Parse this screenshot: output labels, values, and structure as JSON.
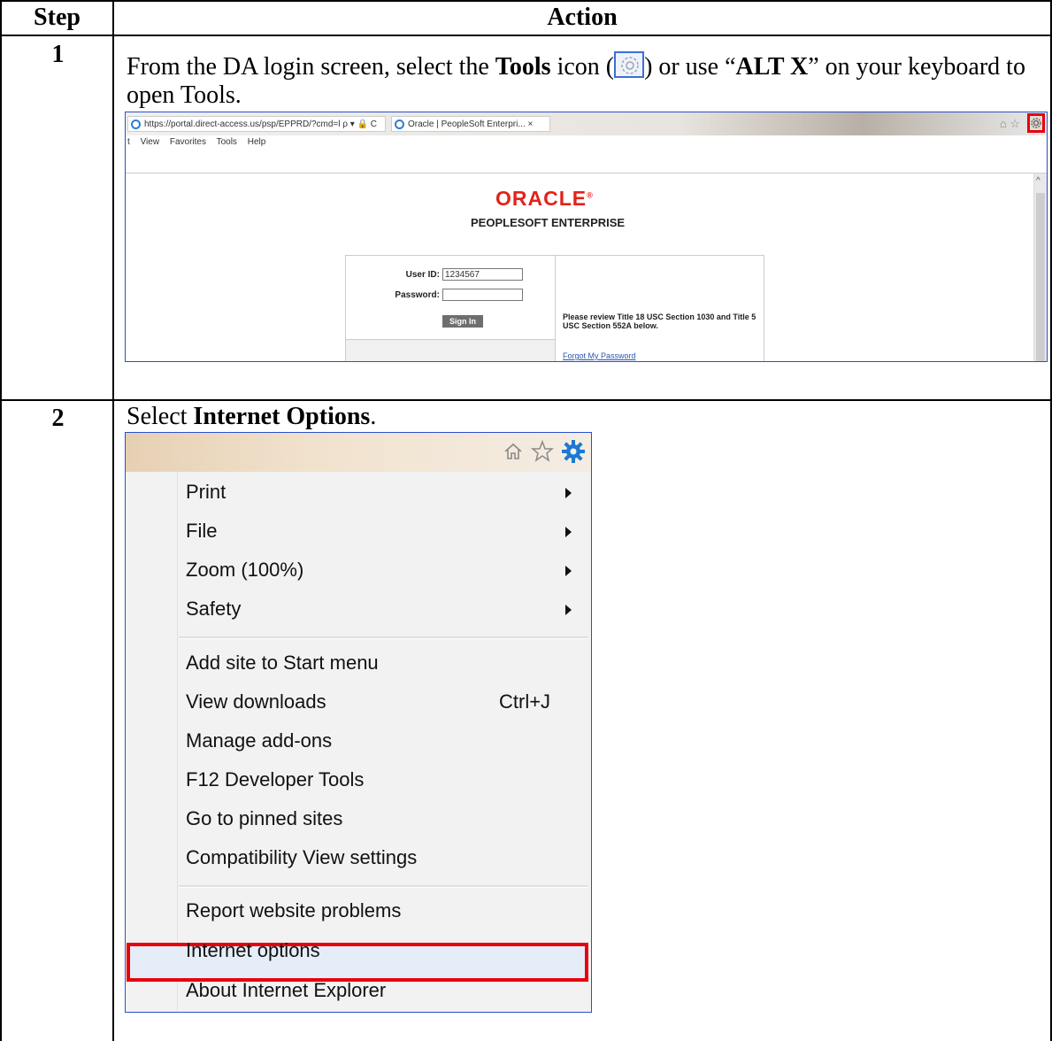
{
  "table": {
    "headers": {
      "step": "Step",
      "action": "Action"
    },
    "rows": [
      {
        "step": "1",
        "text": {
          "p1": "From the DA login screen, select the ",
          "b1": "Tools",
          "p2": " icon (",
          "p3": ") or use “",
          "b2": "ALT X",
          "p4": "” on your keyboard to open Tools."
        }
      },
      {
        "step": "2",
        "text": {
          "p1": "Select ",
          "b1": "Internet Options",
          "p2": "."
        }
      }
    ]
  },
  "screenshot1": {
    "url": "https://portal.direct-access.us/psp/EPPRD/?cmd=l ρ ▾ 🔒 C",
    "tab_title": "Oracle | PeopleSoft Enterpri... ×",
    "menu": [
      "t",
      "View",
      "Favorites",
      "Tools",
      "Help"
    ],
    "logo": "ORACLE",
    "logo_tm": "®",
    "subtitle": "PEOPLESOFT ENTERPRISE",
    "userid_label": "User ID:",
    "userid_value": "1234567",
    "password_label": "Password:",
    "password_value": "",
    "signin": "Sign In",
    "review_text": "Please review Title 18 USC Section 1030 and Title 5 USC Section 552A below.",
    "forgot": "Forgot My Password"
  },
  "screenshot2": {
    "menu_items": [
      {
        "label": "Print",
        "submenu": true
      },
      {
        "label": "File",
        "submenu": true
      },
      {
        "label": "Zoom (100%)",
        "submenu": true
      },
      {
        "label": "Safety",
        "submenu": true
      },
      {
        "label": "Add site to Start menu"
      },
      {
        "label": "View downloads",
        "shortcut": "Ctrl+J"
      },
      {
        "label": "Manage add-ons"
      },
      {
        "label": "F12 Developer Tools"
      },
      {
        "label": "Go to pinned sites"
      },
      {
        "label": "Compatibility View settings"
      },
      {
        "label": "Report website problems"
      },
      {
        "label": "Internet options",
        "highlighted": true
      },
      {
        "label": "About Internet Explorer"
      }
    ]
  },
  "colors": {
    "highlight_box": "#e8000b",
    "screenshot_border": "#2a4fd0",
    "gear_blue": "#1f78d1",
    "oracle_red": "#e2231a"
  },
  "icons": [
    "gear-icon",
    "home-icon",
    "star-icon",
    "ie-icon",
    "chevron-right-icon"
  ]
}
